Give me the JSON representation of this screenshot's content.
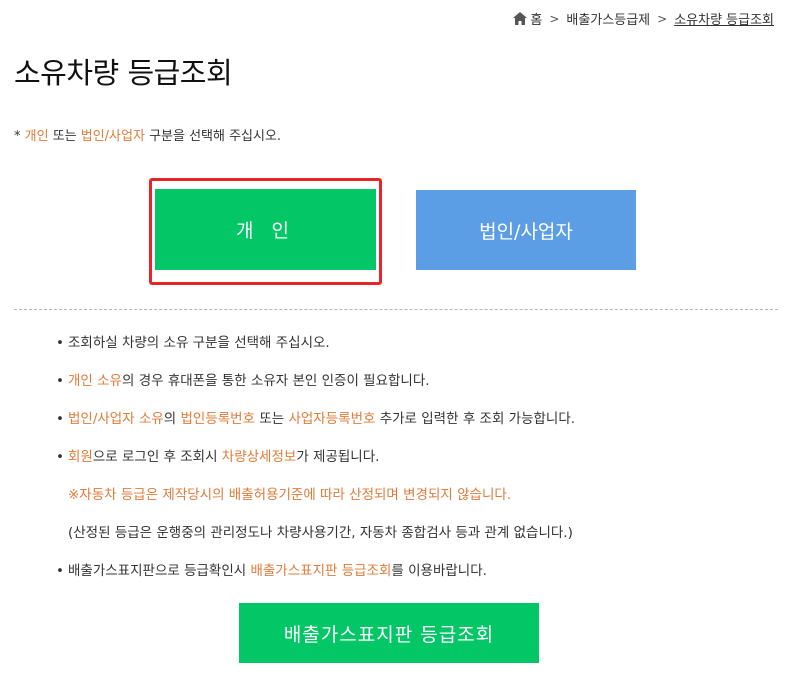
{
  "breadcrumb": {
    "home": "홈",
    "level1": "배출가스등급제",
    "current": "소유차량 등급조회",
    "separator": ">"
  },
  "page_title": "소유차량 등급조회",
  "instruction": {
    "prefix": "* ",
    "personal": "개인",
    "mid1": " 또는 ",
    "corporate": "법인/사업자",
    "suffix": " 구분을 선택해 주십시오."
  },
  "buttons": {
    "personal": "개 인",
    "corporate": "법인/사업자",
    "sign": "배출가스표지판 등급조회"
  },
  "notes": {
    "bullet": "•",
    "n1": "조회하실 차량의 소유 구분을 선택해 주십시오.",
    "n2_hl": "개인 소유",
    "n2_rest": "의 경우 휴대폰을 통한 소유자 본인 인증이 필요합니다.",
    "n3_hl1": "법인/사업자 소유",
    "n3_t1": "의 ",
    "n3_hl2": "법인등록번호",
    "n3_t2": " 또는 ",
    "n3_hl3": "사업자등록번호",
    "n3_t3": " 추가로 입력한 후 조회 가능합니다.",
    "n4_hl1": "회원",
    "n4_t1": "으로 로그인 후 조회시 ",
    "n4_hl2": "차량상세정보",
    "n4_t2": "가 제공됩니다.",
    "n4_sub1": "※자동차 등급은 제작당시의 배출허용기준에 따라 산정되며 변경되지 않습니다.",
    "n4_sub2": "(산정된 등급은 운행중의 관리정도나 차량사용기간, 자동차 종합검사 등과 관계 없습니다.)",
    "n5_t1": "배출가스표지판으로 등급확인시 ",
    "n5_hl": "배출가스표지판 등급조회",
    "n5_t2": "를 이용바랍니다."
  },
  "colors": {
    "highlight": "#e07b39",
    "green_button": "#03c766",
    "blue_button": "#5b9ee6",
    "selection_frame": "#e8262a"
  },
  "icons": {
    "home": "home-icon"
  }
}
